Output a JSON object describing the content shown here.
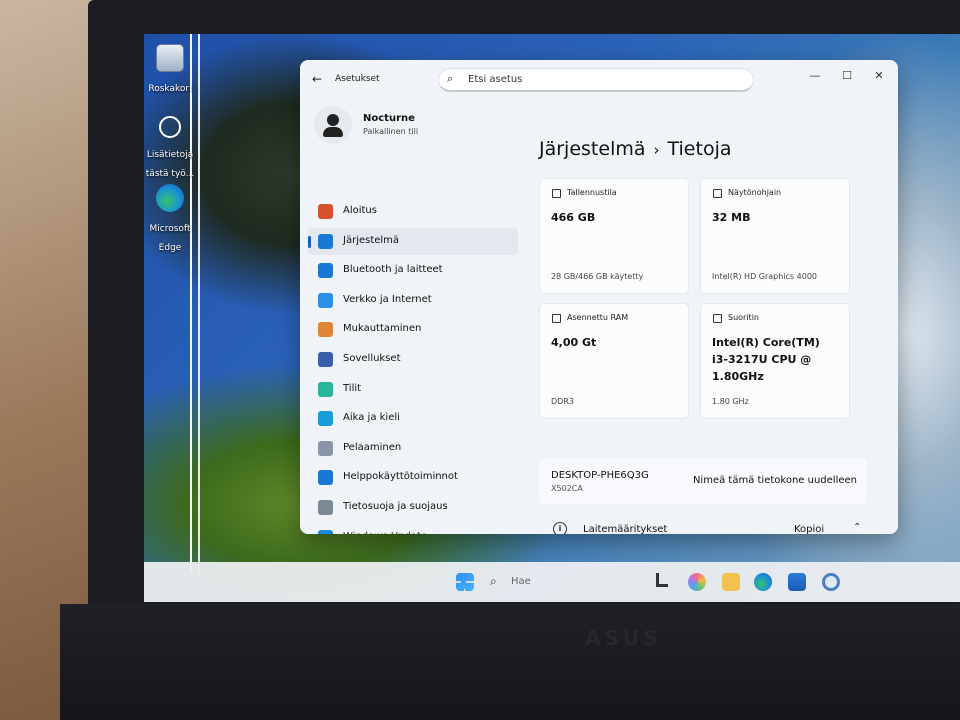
{
  "desktop": {
    "icons": [
      {
        "label": "Roskakori",
        "icon": "recycle-bin-icon"
      },
      {
        "label": "Lisätietoja tästä työ...",
        "icon": "info-circle-icon"
      },
      {
        "label": "Microsoft Edge",
        "icon": "edge-icon"
      }
    ]
  },
  "window": {
    "title": "Asetukset",
    "search_placeholder": "Etsi asetus",
    "controls": {
      "minimize": "—",
      "maximize": "☐",
      "close": "✕"
    }
  },
  "user": {
    "name": "Nocturne",
    "account": "Paikallinen tili"
  },
  "nav": [
    {
      "label": "Aloitus",
      "icon": "home-icon",
      "color": "#d5532c"
    },
    {
      "label": "Järjestelmä",
      "icon": "monitor-icon",
      "color": "#1a78d4",
      "active": true
    },
    {
      "label": "Bluetooth ja laitteet",
      "icon": "bluetooth-icon",
      "color": "#1a78d4"
    },
    {
      "label": "Verkko ja Internet",
      "icon": "wifi-icon",
      "color": "#2b8fe6"
    },
    {
      "label": "Mukauttaminen",
      "icon": "brush-icon",
      "color": "#e0843a"
    },
    {
      "label": "Sovellukset",
      "icon": "apps-icon",
      "color": "#3a5fa8"
    },
    {
      "label": "Tilit",
      "icon": "person-icon",
      "color": "#2ab49a"
    },
    {
      "label": "Aika ja kieli",
      "icon": "globe-clock-icon",
      "color": "#1a9ad8"
    },
    {
      "label": "Pelaaminen",
      "icon": "gamepad-icon",
      "color": "#8a96a8"
    },
    {
      "label": "Helppokäyttötoiminnot",
      "icon": "accessibility-icon",
      "color": "#1a78d4"
    },
    {
      "label": "Tietosuoja ja suojaus",
      "icon": "shield-icon",
      "color": "#7d8896"
    },
    {
      "label": "Windows Update",
      "icon": "update-icon",
      "color": "#1a8ad8"
    }
  ],
  "breadcrumb": {
    "parent": "Järjestelmä",
    "separator": "›",
    "current": "Tietoja"
  },
  "cards": [
    {
      "label": "Tallennustila",
      "value": "466 GB",
      "footer": "28 GB/466 GB käytetty",
      "icon": "storage-icon"
    },
    {
      "label": "Näytönohjain",
      "value": "32 MB",
      "footer": "Intel(R) HD Graphics 4000",
      "icon": "gpu-icon"
    },
    {
      "label": "Asennettu RAM",
      "value": "4,00 Gt",
      "footer": "DDR3",
      "icon": "ram-icon"
    },
    {
      "label": "Suoritin",
      "value": "Intel(R) Core(TM) i3-3217U CPU @ 1.80GHz",
      "footer": "1.80 GHz",
      "icon": "cpu-icon"
    }
  ],
  "device": {
    "name": "DESKTOP-PHE6Q3G",
    "model": "X502CA",
    "rename_label": "Nimeä tämä tietokone uudelleen"
  },
  "specs": {
    "label": "Laitemääritykset",
    "copy_label": "Kopioi"
  },
  "taskbar": {
    "search_label": "Hae"
  },
  "laptop": {
    "brand": "ASUS"
  }
}
